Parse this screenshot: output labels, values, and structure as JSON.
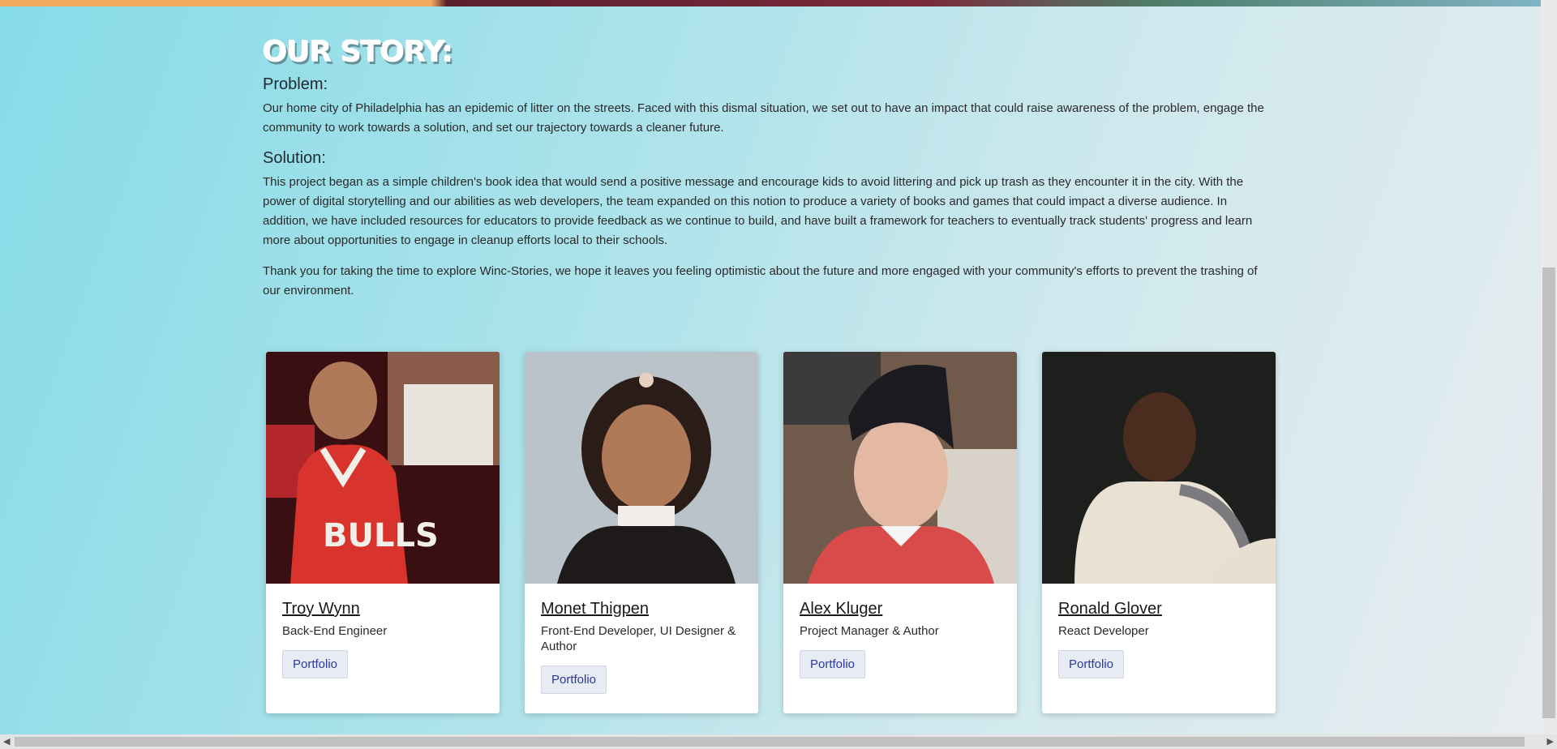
{
  "story": {
    "title": "OUR STORY:",
    "problem_heading": "Problem:",
    "problem_text": "Our home city of Philadelphia has an epidemic of litter on the streets. Faced with this dismal situation, we set out to have an impact that could raise awareness of the problem, engage the community to work towards a solution, and set our trajectory towards a cleaner future.",
    "solution_heading": "Solution:",
    "solution_text": "This project began as a simple children's book idea that would send a positive message and encourage kids to avoid littering and pick up trash as they encounter it in the city. With the power of digital storytelling and our abilities as web developers, the team expanded on this notion to produce a variety of books and games that could impact a diverse audience. In addition, we have included resources for educators to provide feedback as we continue to build, and have built a framework for teachers to eventually track students' progress and learn more about opportunities to engage in cleanup efforts local to their schools.",
    "thanks_text": "Thank you for taking the time to explore Winc-Stories, we hope it leaves you feeling optimistic about the future and more engaged with your community's efforts to prevent the trashing of our environment."
  },
  "team": [
    {
      "name": "Troy Wynn",
      "role": "Back-End Engineer",
      "button": "Portfolio"
    },
    {
      "name": "Monet Thigpen",
      "role": "Front-End Developer, UI Designer & Author",
      "button": "Portfolio"
    },
    {
      "name": "Alex Kluger",
      "role": "Project Manager & Author",
      "button": "Portfolio"
    },
    {
      "name": "Ronald Glover",
      "role": "React Developer",
      "button": "Portfolio"
    }
  ],
  "scrollbar": {
    "left_arrow": "◀",
    "right_arrow": "▶"
  }
}
